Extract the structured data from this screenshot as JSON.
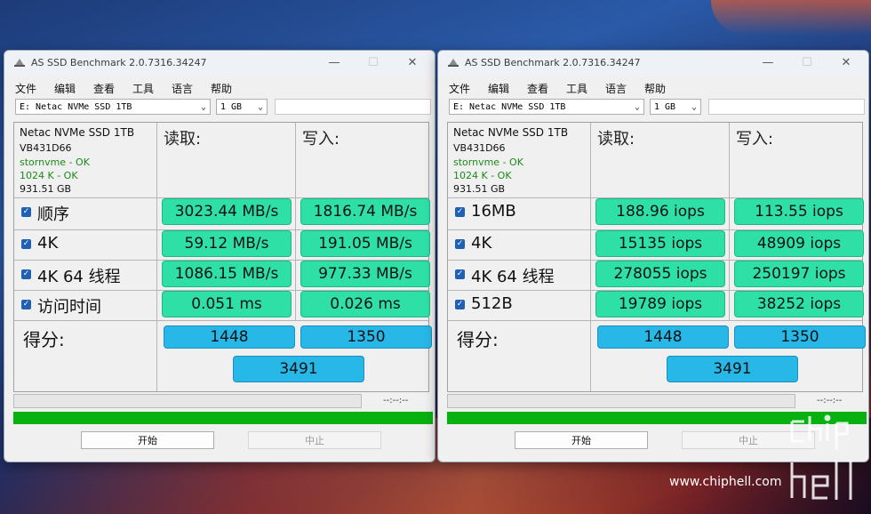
{
  "windows": [
    {
      "title": "AS SSD Benchmark 2.0.7316.34247",
      "menu": [
        "文件",
        "编辑",
        "查看",
        "工具",
        "语言",
        "帮助"
      ],
      "drive_select": "E: Netac NVMe SSD 1TB",
      "size_select": "1 GB",
      "info": {
        "model": "Netac NVMe SSD 1TB",
        "firmware": "VB431D66",
        "driver": "stornvme - OK",
        "align": "1024 K - OK",
        "capacity": "931.51 GB"
      },
      "headers": {
        "read": "读取:",
        "write": "写入:"
      },
      "rows": [
        {
          "label": "顺序",
          "read": "3023.44 MB/s",
          "write": "1816.74 MB/s"
        },
        {
          "label": "4K",
          "read": "59.12 MB/s",
          "write": "191.05 MB/s"
        },
        {
          "label": "4K 64 线程",
          "read": "1086.15 MB/s",
          "write": "977.33 MB/s"
        },
        {
          "label": "访问时间",
          "read": "0.051 ms",
          "write": "0.026 ms"
        }
      ],
      "score_label": "得分:",
      "score_read": "1448",
      "score_write": "1350",
      "score_total": "3491",
      "time": "--:--:--",
      "start_label": "开始",
      "stop_label": "中止"
    },
    {
      "title": "AS SSD Benchmark 2.0.7316.34247",
      "menu": [
        "文件",
        "编辑",
        "查看",
        "工具",
        "语言",
        "帮助"
      ],
      "drive_select": "E: Netac NVMe SSD 1TB",
      "size_select": "1 GB",
      "info": {
        "model": "Netac NVMe SSD 1TB",
        "firmware": "VB431D66",
        "driver": "stornvme - OK",
        "align": "1024 K - OK",
        "capacity": "931.51 GB"
      },
      "headers": {
        "read": "读取:",
        "write": "写入:"
      },
      "rows": [
        {
          "label": "16MB",
          "read": "188.96 iops",
          "write": "113.55 iops"
        },
        {
          "label": "4K",
          "read": "15135 iops",
          "write": "48909 iops"
        },
        {
          "label": "4K 64 线程",
          "read": "278055 iops",
          "write": "250197 iops"
        },
        {
          "label": "512B",
          "read": "19789 iops",
          "write": "38252 iops"
        }
      ],
      "score_label": "得分:",
      "score_read": "1448",
      "score_write": "1350",
      "score_total": "3491",
      "time": "--:--:--",
      "start_label": "开始",
      "stop_label": "中止"
    }
  ],
  "watermark": "www.chiphell.com",
  "logo_text": "chip hell",
  "colors": {
    "value_box": "#2fe0a6",
    "score_box": "#27b8e8",
    "progress_green": "#07b10f"
  }
}
